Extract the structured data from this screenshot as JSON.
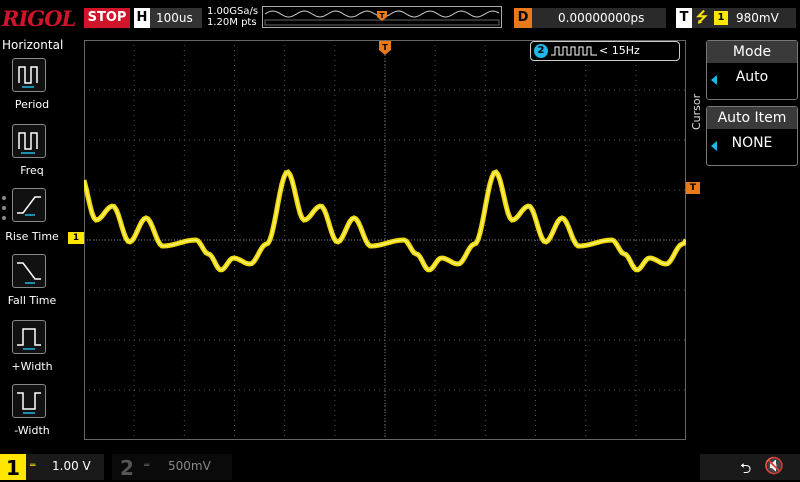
{
  "header": {
    "brand": "RIGOL",
    "run_state": "STOP",
    "timebase_label": "H",
    "timebase_value": "100us",
    "sample_rate": "1.00GSa/s",
    "memory_depth": "1.20M pts",
    "trigger_pos_marker": "T",
    "delay_label": "D",
    "delay_value": "0.00000000ps",
    "trigger_label": "T",
    "trigger_channel": "1",
    "trigger_level": "980mV"
  },
  "left_menu": {
    "title": "Horizontal",
    "items": [
      {
        "label": "Period",
        "icon": "period-icon"
      },
      {
        "label": "Freq",
        "icon": "frequency-icon"
      },
      {
        "label": "Rise Time",
        "icon": "rise-time-icon"
      },
      {
        "label": "Fall Time",
        "icon": "fall-time-icon"
      },
      {
        "label": "+Width",
        "icon": "positive-width-icon"
      },
      {
        "label": "-Width",
        "icon": "negative-width-icon"
      }
    ]
  },
  "right_menu": {
    "section_label": "Cursor",
    "mode": {
      "title": "Mode",
      "value": "Auto"
    },
    "auto_item": {
      "title": "Auto Item",
      "value": "NONE"
    }
  },
  "channel2_freq": {
    "channel": "2",
    "text": "< 15Hz"
  },
  "markers": {
    "ch1_level": "1",
    "trigger_level": "T"
  },
  "footer": {
    "ch1": {
      "num": "1",
      "coupling_icon": "dc-coupling-icon",
      "scale": "1.00 V"
    },
    "ch2": {
      "num": "2",
      "coupling_icon": "dc-coupling-icon",
      "scale": "500mV"
    }
  },
  "colors": {
    "ch1": "#ffe600",
    "ch2": "#1fb8e8",
    "trigger": "#e97a1b",
    "brand": "#d0142a"
  }
}
